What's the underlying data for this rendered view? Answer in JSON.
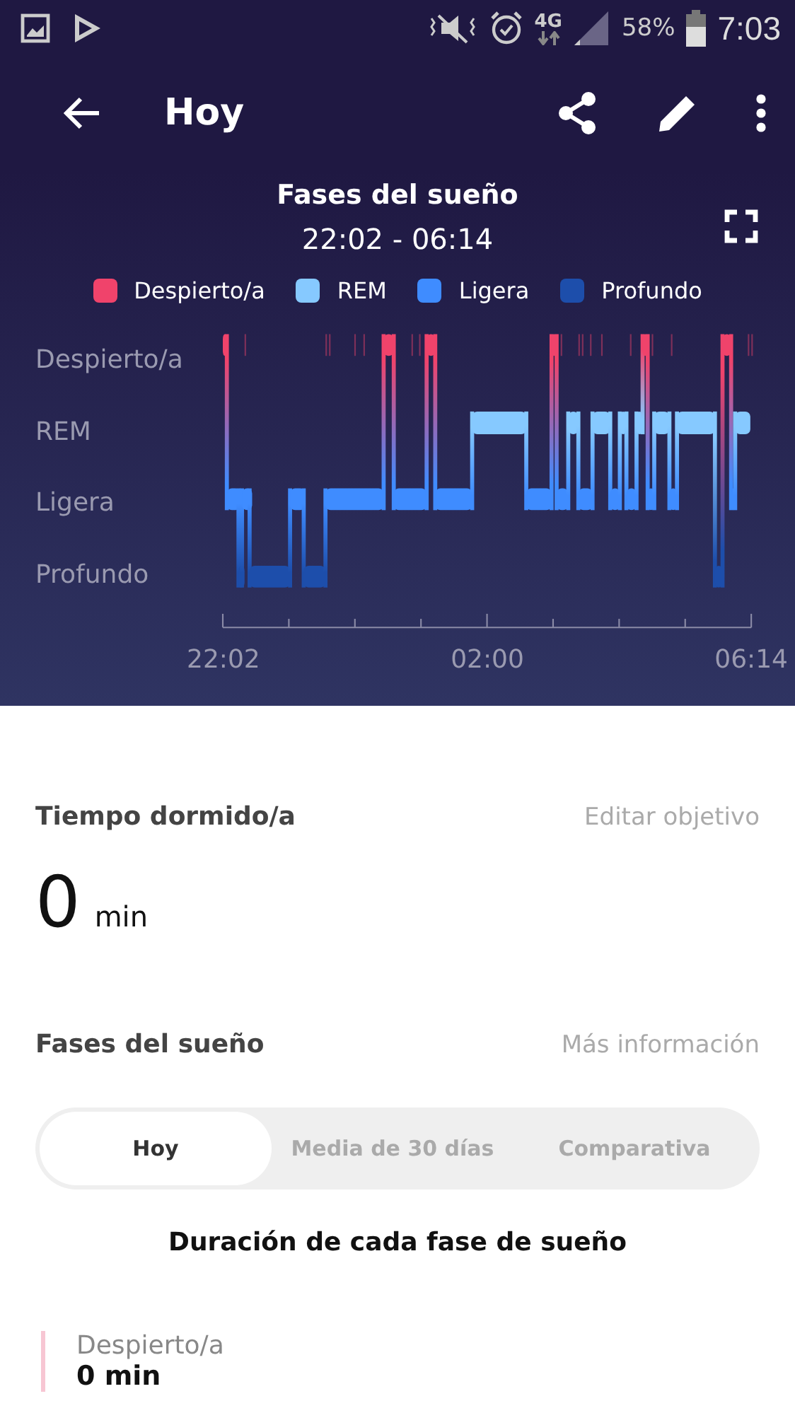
{
  "status_bar": {
    "network": "4G",
    "battery": "58%",
    "time": "7:03"
  },
  "toolbar": {
    "title": "Hoy"
  },
  "chart": {
    "title": "Fases del sueño",
    "range": "22:02 - 06:14",
    "legend": [
      {
        "label": "Despierto/a",
        "color": "#f0436b"
      },
      {
        "label": "REM",
        "color": "#86c9ff"
      },
      {
        "label": "Ligera",
        "color": "#3f8cff"
      },
      {
        "label": "Profundo",
        "color": "#1d4eab"
      }
    ],
    "y_labels": [
      "Despierto/a",
      "REM",
      "Ligera",
      "Profundo"
    ],
    "x_labels": [
      "22:02",
      "02:00",
      "06:14"
    ]
  },
  "sleep_time": {
    "label": "Tiempo dormido/a",
    "link": "Editar objetivo",
    "value": "0",
    "unit": "min"
  },
  "stages": {
    "label": "Fases del sueño",
    "link": "Más información",
    "tabs": [
      {
        "label": "Hoy",
        "selected": true
      },
      {
        "label": "Media de 30 días",
        "selected": false
      },
      {
        "label": "Comparativa",
        "selected": false
      }
    ],
    "subtitle": "Duración de cada fase de sueño",
    "items": [
      {
        "name": "Despierto/a",
        "value": "0 min",
        "color": "#f7c6d3"
      }
    ]
  }
}
